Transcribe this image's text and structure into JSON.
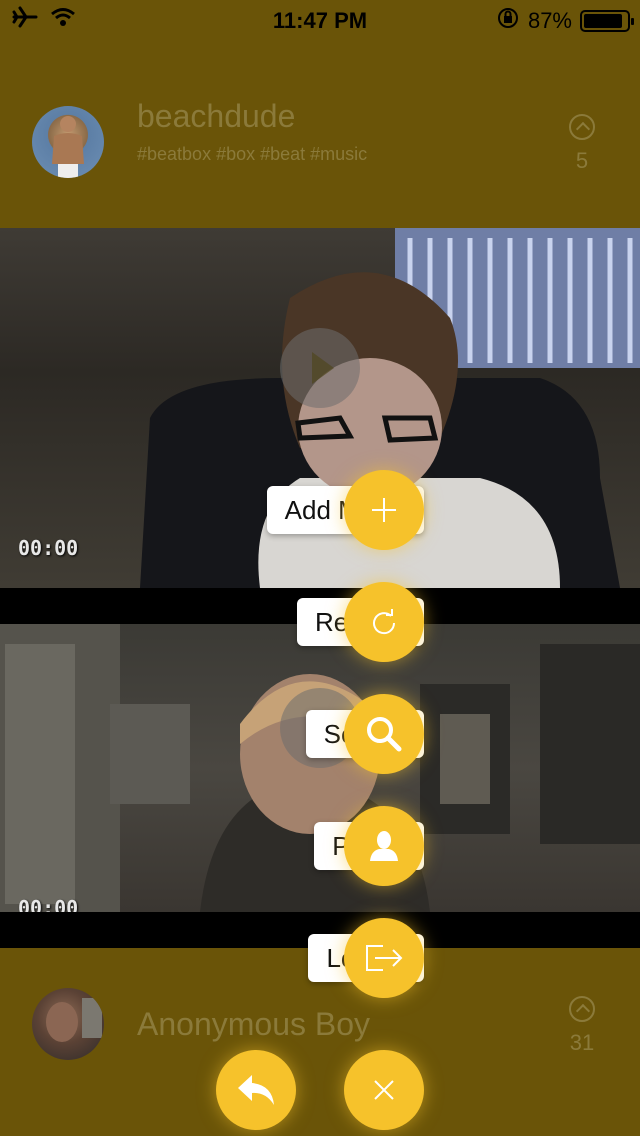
{
  "status_bar": {
    "time": "11:47 PM",
    "battery": "87%",
    "icons": [
      "airplane-icon",
      "wifi-icon",
      "rotation-lock-icon",
      "battery-icon"
    ]
  },
  "posts": [
    {
      "username": "beachdude",
      "tags": "#beatbox #box #beat #music",
      "votes": "5",
      "timestamp": "00:00"
    },
    {
      "username": "Anonymous Boy",
      "votes": "31",
      "timestamp": "00:00"
    }
  ],
  "menu": {
    "items": [
      {
        "label": "Add Mimic",
        "icon": "plus-icon"
      },
      {
        "label": "Refresh",
        "icon": "refresh-icon"
      },
      {
        "label": "Search",
        "icon": "search-icon"
      },
      {
        "label": "Profile",
        "icon": "person-icon"
      },
      {
        "label": "Logout",
        "icon": "logout-icon"
      }
    ],
    "back_icon": "reply-icon",
    "close_icon": "close-icon"
  },
  "colors": {
    "accent": "#f6c22b",
    "header_bg": "#6a5408",
    "muted_text": "#8b7a3a"
  }
}
